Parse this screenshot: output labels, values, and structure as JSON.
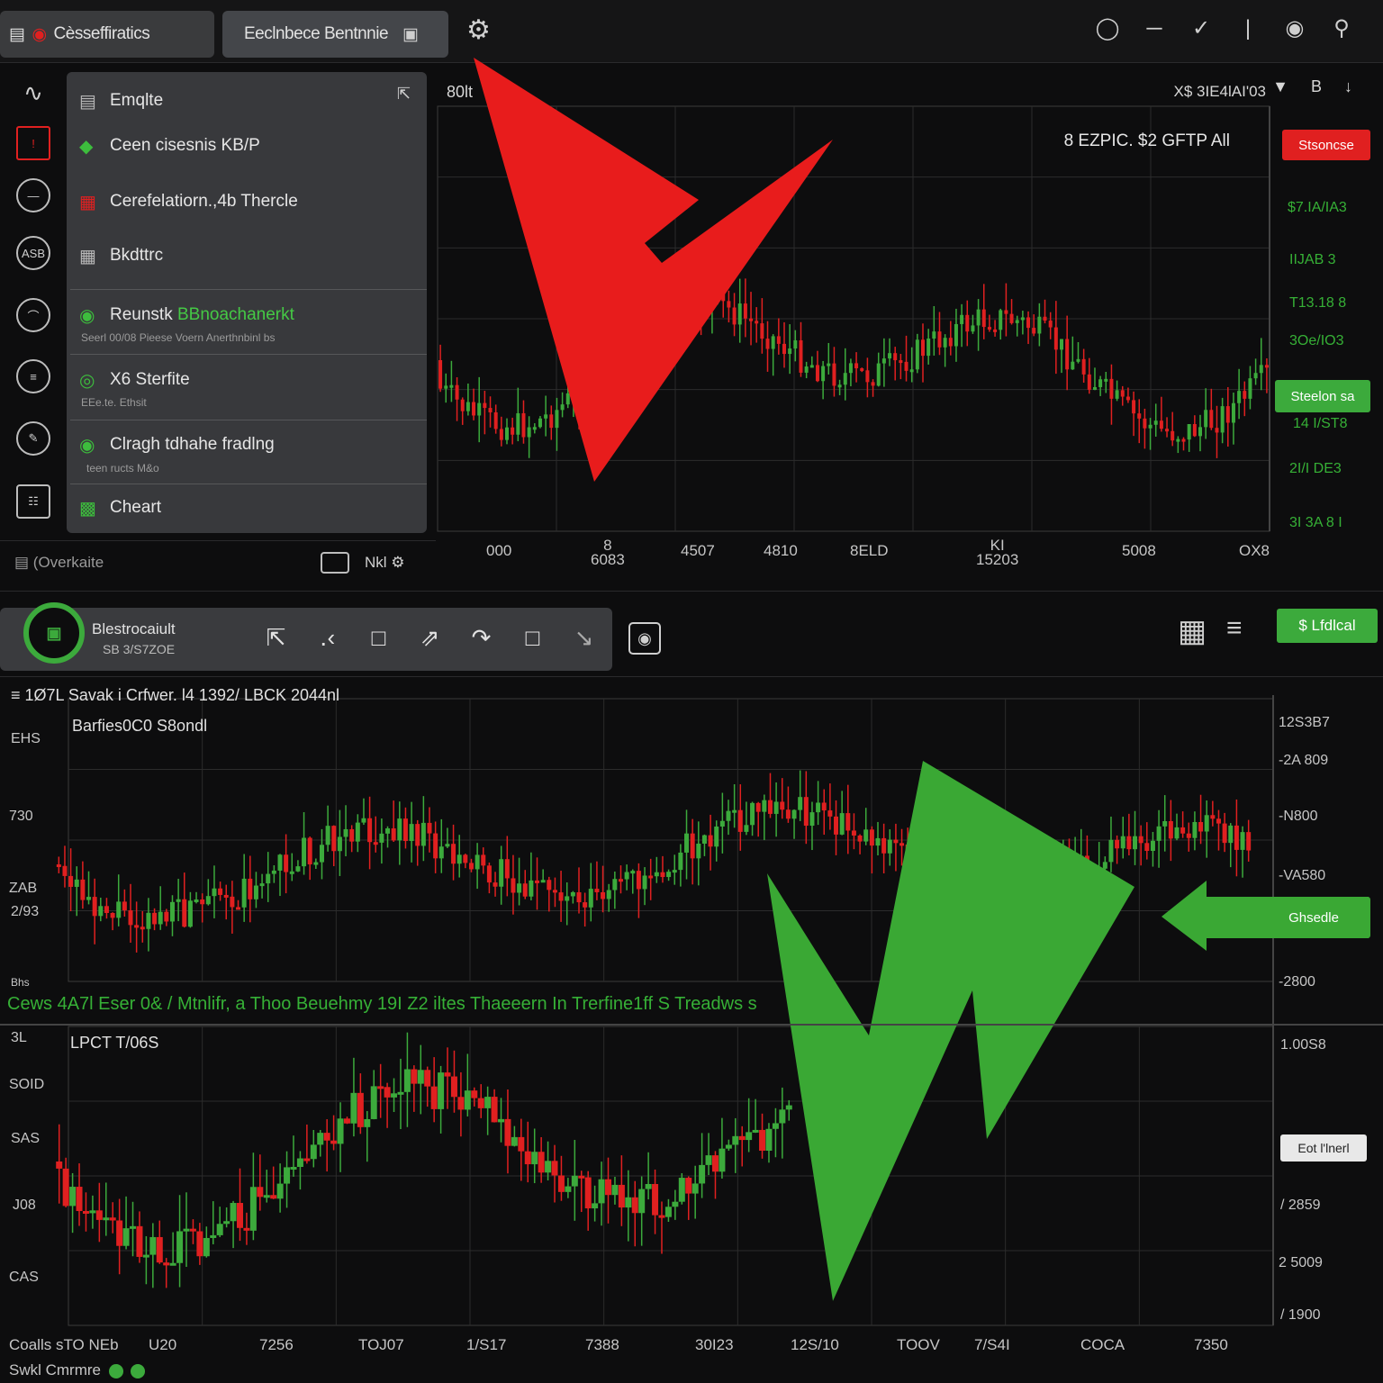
{
  "topbar": {
    "tabs": [
      {
        "label": "Cèsseffiratics",
        "icon": "document-icon"
      },
      {
        "label": "Eeclnbece Bentnnie",
        "icon": "lock-icon"
      }
    ],
    "right_icons": [
      "clock-icon",
      "menu-icon",
      "pencil-icon",
      "divider",
      "circle-icon",
      "search-icon"
    ]
  },
  "rail": {
    "items": [
      {
        "label": "",
        "icon": "trend-icon"
      },
      {
        "label": "!",
        "icon": "alert-icon"
      },
      {
        "label": "",
        "icon": "minus-icon"
      },
      {
        "label": "ASB",
        "icon": "asb-icon"
      },
      {
        "label": "",
        "icon": "arc-icon"
      },
      {
        "label": "",
        "icon": "split-icon"
      },
      {
        "label": "",
        "icon": "pen-icon"
      },
      {
        "label": "",
        "icon": "settings-icon"
      }
    ]
  },
  "menu": {
    "items": [
      {
        "label": "Emqlte",
        "sub": ""
      },
      {
        "label": "Ceen cisesnis KB/P",
        "sub": ""
      },
      {
        "label": "Cerefelatiorn.,4b Thercle",
        "sub": ""
      },
      {
        "label": "Bkdttrc",
        "sub": ""
      },
      {
        "label": "Reunstk",
        "label_green": "BBnoachanerkt",
        "sub": "Seerl 00/08 Pieese Voern Anerthnbinl bs"
      },
      {
        "label": "X6 Sterfite",
        "sub": "EEe.te. Ethsit"
      },
      {
        "label": "Clragh tdhahe fradlng",
        "sub": "teen ructs M&o"
      },
      {
        "label": "Cheart",
        "sub": ""
      }
    ]
  },
  "left_footer": {
    "text": "(Overkaite",
    "right_label": "Nkl"
  },
  "pane1": {
    "title_left": "80lt",
    "title_right": "X$ 3IE4lAI'03",
    "controls": "B",
    "info": "8 EZPIC.  $2 GFTP All",
    "badge_top": "Stsoncse",
    "badge_mid": "Steelon sa",
    "y_ticks": [
      "$7.IA/IA3",
      "IIJAB 3",
      "T13.18 8",
      "3Oe/IO3",
      "14 I/ST8",
      "2I/I  DE3",
      "3I 3A 8 I"
    ],
    "x_ticks": [
      "000",
      "8\n6083",
      "4507",
      "4810",
      "8ELD",
      "KI\n15203",
      "5008",
      "OX8"
    ]
  },
  "strip": {
    "title": "Blestrocaiult",
    "subtitle": "SB 3/S7ZOE",
    "tool_icons": [
      "cursor-icon",
      "dots-icon",
      "rect-icon",
      "arrow-up-icon",
      "curve-icon",
      "box-icon",
      "arrow-draw-icon"
    ],
    "badge": "$ Lfdlcal"
  },
  "pane2": {
    "head": "1Ø7L Savak i Crfwer.  l4 1392/ LBCK 2044nl",
    "sub": "Barfies0C0 S8ondl",
    "left_ticks": [
      "EHS",
      "730",
      "ZAB",
      "2/93",
      "Bhs"
    ],
    "right_ticks": [
      "12S3B7",
      "-2A 809",
      "-N800",
      "-VA580",
      "-2800"
    ],
    "badge": "Ghsedle",
    "ticker": "Cews 4A7l Eser 0& / Mtnlifr, a Thoo Beuehmy 19I  Z2 iltes Thaeeern In Trerfine1ff S Treadws s"
  },
  "pane3": {
    "title": "LPCT T/06S",
    "left_ticks": [
      "3L",
      "SOID",
      "SAS",
      "J08",
      "CAS"
    ],
    "right_ticks": [
      "1.00S8",
      "/ 2859",
      "2 5009",
      "/ 1900"
    ],
    "badge": "Eot l'lnerl",
    "x_ticks": [
      "U20",
      "7256",
      "TOJ07",
      "1/S17",
      "7388",
      "30I23",
      "12S/10",
      "TOOV",
      "7/S4I",
      "COCA",
      "7350"
    ],
    "bottom_l1": "Coalls sTO NEb",
    "bottom_l2": "Swkl Cmrmre"
  },
  "colors": {
    "up": "#3caa3c",
    "down": "#e02020",
    "bg": "#0d0d0e"
  }
}
